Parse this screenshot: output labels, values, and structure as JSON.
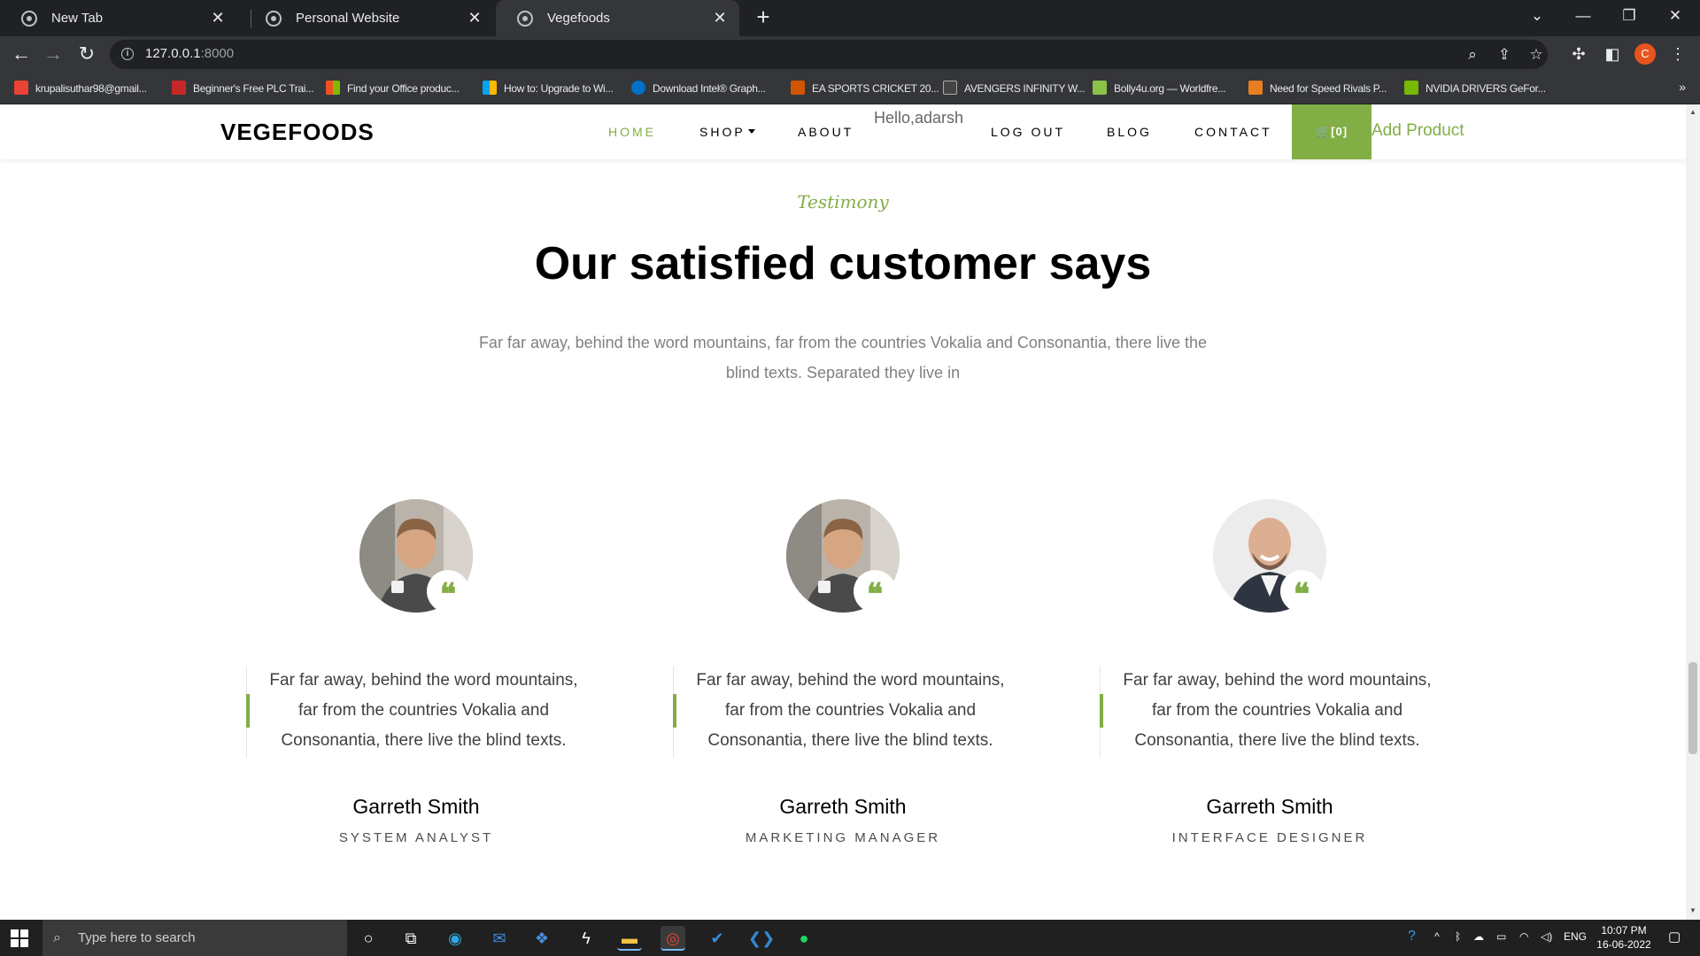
{
  "browser": {
    "tabs": [
      {
        "title": "New Tab",
        "active": false
      },
      {
        "title": "Personal Website",
        "active": false
      },
      {
        "title": "Vegefoods",
        "active": true
      }
    ],
    "url_host": "127.0.0.1",
    "url_port": ":8000",
    "profile_initial": "C",
    "bookmarks": [
      "krupalisuthar98@gmail...",
      "Beginner's Free PLC Trai...",
      "Find your Office produc...",
      "How to: Upgrade to Wi...",
      "Download Intel® Graph...",
      "EA SPORTS CRICKET 20...",
      "AVENGERS INFINITY W...",
      "Bolly4u.org — Worldfre...",
      "Need for Speed Rivals P...",
      "NVIDIA DRIVERS GeFor..."
    ],
    "bookmark_colors": [
      "#ea4335",
      "#c62828",
      "#f25022",
      "#f25022",
      "#0071c5",
      "#d35400",
      "#444444",
      "#8bc34a",
      "#e67e22",
      "#76b900"
    ]
  },
  "site": {
    "brand": "VEGEFOODS",
    "nav": {
      "home": "HOME",
      "shop": "SHOP",
      "about": "ABOUT",
      "greeting": "Hello,adarsh",
      "logout": "LOG OUT",
      "blog": "BLOG",
      "contact": "CONTACT",
      "cart": "[0]",
      "add_product": "Add Product"
    },
    "accent_color": "#82ae46"
  },
  "testimony": {
    "subheading": "Testimony",
    "heading": "Our satisfied customer says",
    "intro": "Far far away, behind the word mountains, far from the countries Vokalia and Consonantia, there live the blind texts. Separated they live in",
    "cards": [
      {
        "text": "Far far away, behind the word mountains, far from the countries Vokalia and Consonantia, there live the blind texts.",
        "name": "Garreth Smith",
        "role": "SYSTEM ANALYST",
        "quote": "❝"
      },
      {
        "text": "Far far away, behind the word mountains, far from the countries Vokalia and Consonantia, there live the blind texts.",
        "name": "Garreth Smith",
        "role": "MARKETING MANAGER",
        "quote": "❝"
      },
      {
        "text": "Far far away, behind the word mountains, far from the countries Vokalia and Consonantia, there live the blind texts.",
        "name": "Garreth Smith",
        "role": "INTERFACE DESIGNER",
        "quote": "❝"
      }
    ]
  },
  "taskbar": {
    "search_placeholder": "Type here to search",
    "language": "ENG",
    "time": "10:07 PM",
    "date": "16-06-2022"
  }
}
